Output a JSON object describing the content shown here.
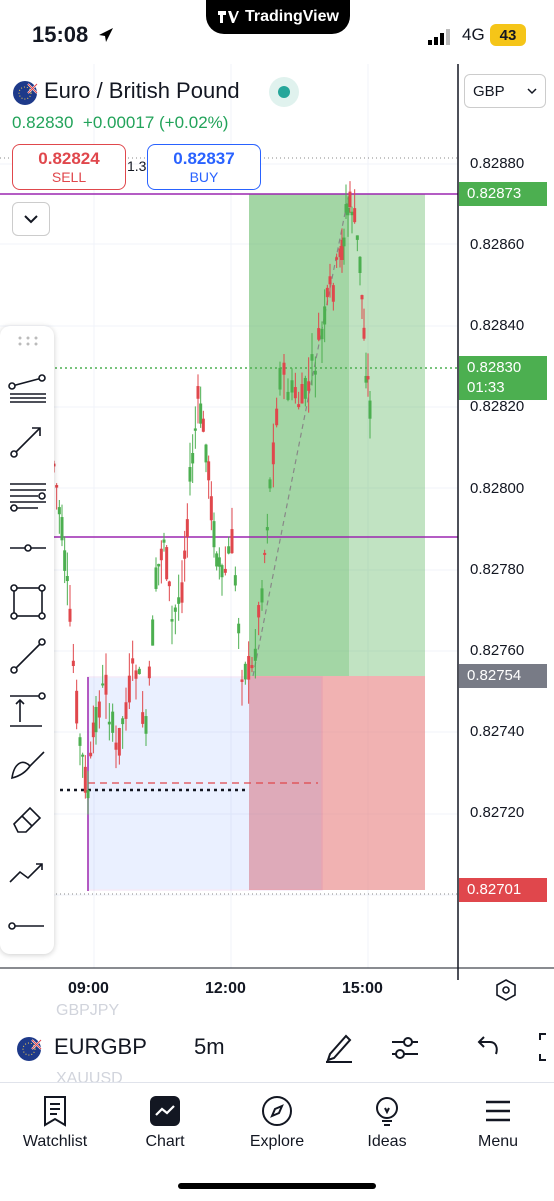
{
  "status": {
    "time": "15:08",
    "network": "4G",
    "battery": "43",
    "dynamic_island": "TradingView"
  },
  "header": {
    "symbol_name": "Euro / British Pound",
    "last_price": "0.82830",
    "change": "+0.00017 (+0.02%)",
    "sell": {
      "price": "0.82824",
      "label": "SELL"
    },
    "buy": {
      "price": "0.82837",
      "label": "BUY"
    },
    "spread": "1.3",
    "currency": "GBP"
  },
  "axis": {
    "prices": [
      "0.82880",
      "0.82860",
      "0.82840",
      "0.82820",
      "0.82800",
      "0.82780",
      "0.82760",
      "0.82740",
      "0.82720"
    ],
    "tags": {
      "take_profit": "0.82873",
      "current": "0.82830",
      "countdown": "01:33",
      "entry": "0.82754",
      "stop_loss": "0.82701"
    },
    "times": [
      "09:00",
      "12:00",
      "15:00"
    ]
  },
  "bottom": {
    "symbol": "EURGBP",
    "interval": "5m",
    "ghost_above": "GBPJPY",
    "ghost_below": "XAUUSD"
  },
  "nav": [
    "Watchlist",
    "Chart",
    "Explore",
    "Ideas",
    "Menu"
  ],
  "colors": {
    "up": "#4caf50",
    "down": "#e0474c",
    "accent": "#2962ff",
    "take_profit_zone": "#4caf50",
    "stop_zone": "#e57373"
  }
}
